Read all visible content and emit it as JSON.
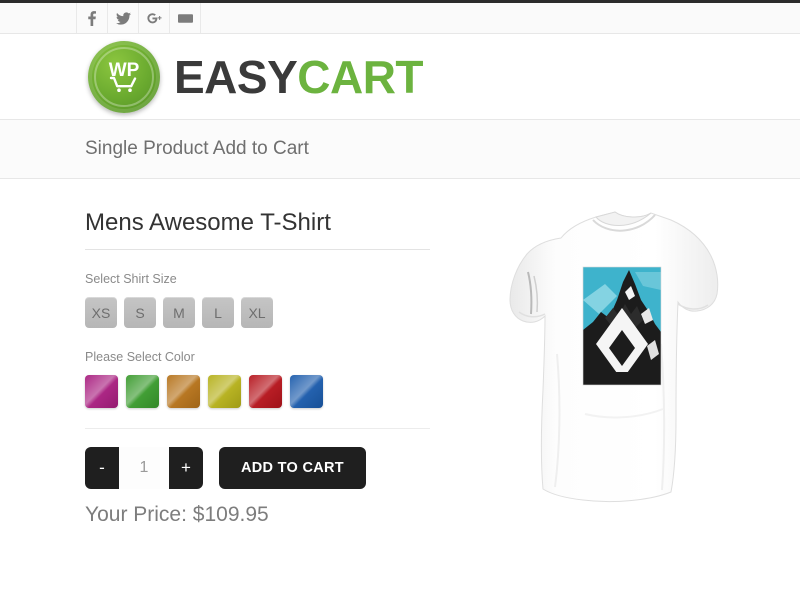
{
  "topbar": {
    "social": [
      {
        "name": "facebook-icon",
        "label": "f"
      },
      {
        "name": "twitter-icon",
        "label": "t"
      },
      {
        "name": "googleplus-icon",
        "label": "g+"
      },
      {
        "name": "email-icon",
        "label": "envelope"
      }
    ]
  },
  "header": {
    "logo_badge_text": "WP",
    "logo_part1": "EASY",
    "logo_part2": "CART",
    "logo_color_dark": "#3a3a3a",
    "logo_color_green": "#6cb33f"
  },
  "page_title": "Single Product Add to Cart",
  "product": {
    "title": "Mens Awesome T-Shirt",
    "size_label": "Select Shirt Size",
    "sizes": [
      "XS",
      "S",
      "M",
      "L",
      "XL"
    ],
    "color_label": "Please Select Color",
    "colors": [
      {
        "name": "magenta",
        "hex": "#a81e7f"
      },
      {
        "name": "green",
        "hex": "#3a9a2d"
      },
      {
        "name": "orange-brown",
        "hex": "#b5721a"
      },
      {
        "name": "olive-yellow",
        "hex": "#b5b01a"
      },
      {
        "name": "red",
        "hex": "#b5141c"
      },
      {
        "name": "blue",
        "hex": "#1b5bab"
      }
    ],
    "quantity": "1",
    "decrease_label": "-",
    "increase_label": "+",
    "add_to_cart_label": "ADD TO CART",
    "price_text": "Your Price: $109.95",
    "image_alt": "White t-shirt with black mountain and diamond graphic",
    "graphic_sky_color": "#3eb3cc",
    "graphic_mountain_color": "#1c1c1c"
  }
}
